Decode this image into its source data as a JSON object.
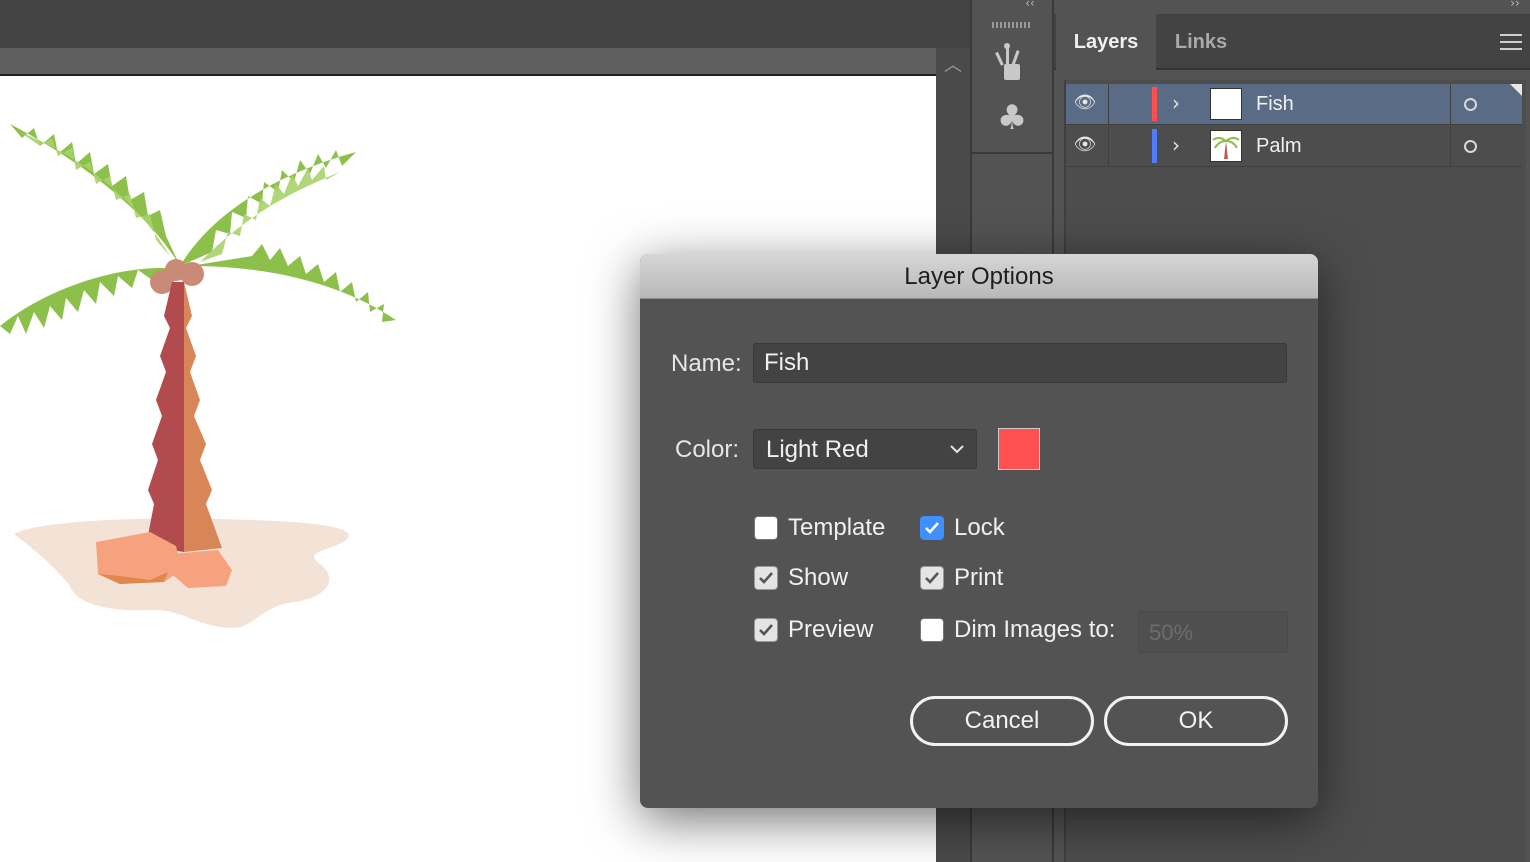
{
  "layers_panel": {
    "tabs": [
      {
        "label": "Layers",
        "active": true
      },
      {
        "label": "Links",
        "active": false
      }
    ],
    "menu_icon": "hamburger-menu-icon",
    "layers": [
      {
        "name": "Fish",
        "visible": true,
        "color": "#ff4f4f",
        "selected": true
      },
      {
        "name": "Palm",
        "visible": true,
        "color": "#4f7dff",
        "selected": false
      }
    ]
  },
  "dock": {
    "icons": [
      "brush-library-icon",
      "symbols-club-icon"
    ]
  },
  "dialog": {
    "title": "Layer Options",
    "name_label": "Name:",
    "name_value": "Fish",
    "color_label": "Color:",
    "color_value": "Light Red",
    "color_swatch": "#ff4f4f",
    "options": {
      "template": {
        "label": "Template",
        "checked": false
      },
      "lock": {
        "label": "Lock",
        "checked": true
      },
      "show": {
        "label": "Show",
        "checked": true
      },
      "print": {
        "label": "Print",
        "checked": true
      },
      "preview": {
        "label": "Preview",
        "checked": true
      },
      "dim": {
        "label": "Dim Images to:",
        "checked": false,
        "value": "50%"
      }
    },
    "cancel_label": "Cancel",
    "ok_label": "OK"
  }
}
